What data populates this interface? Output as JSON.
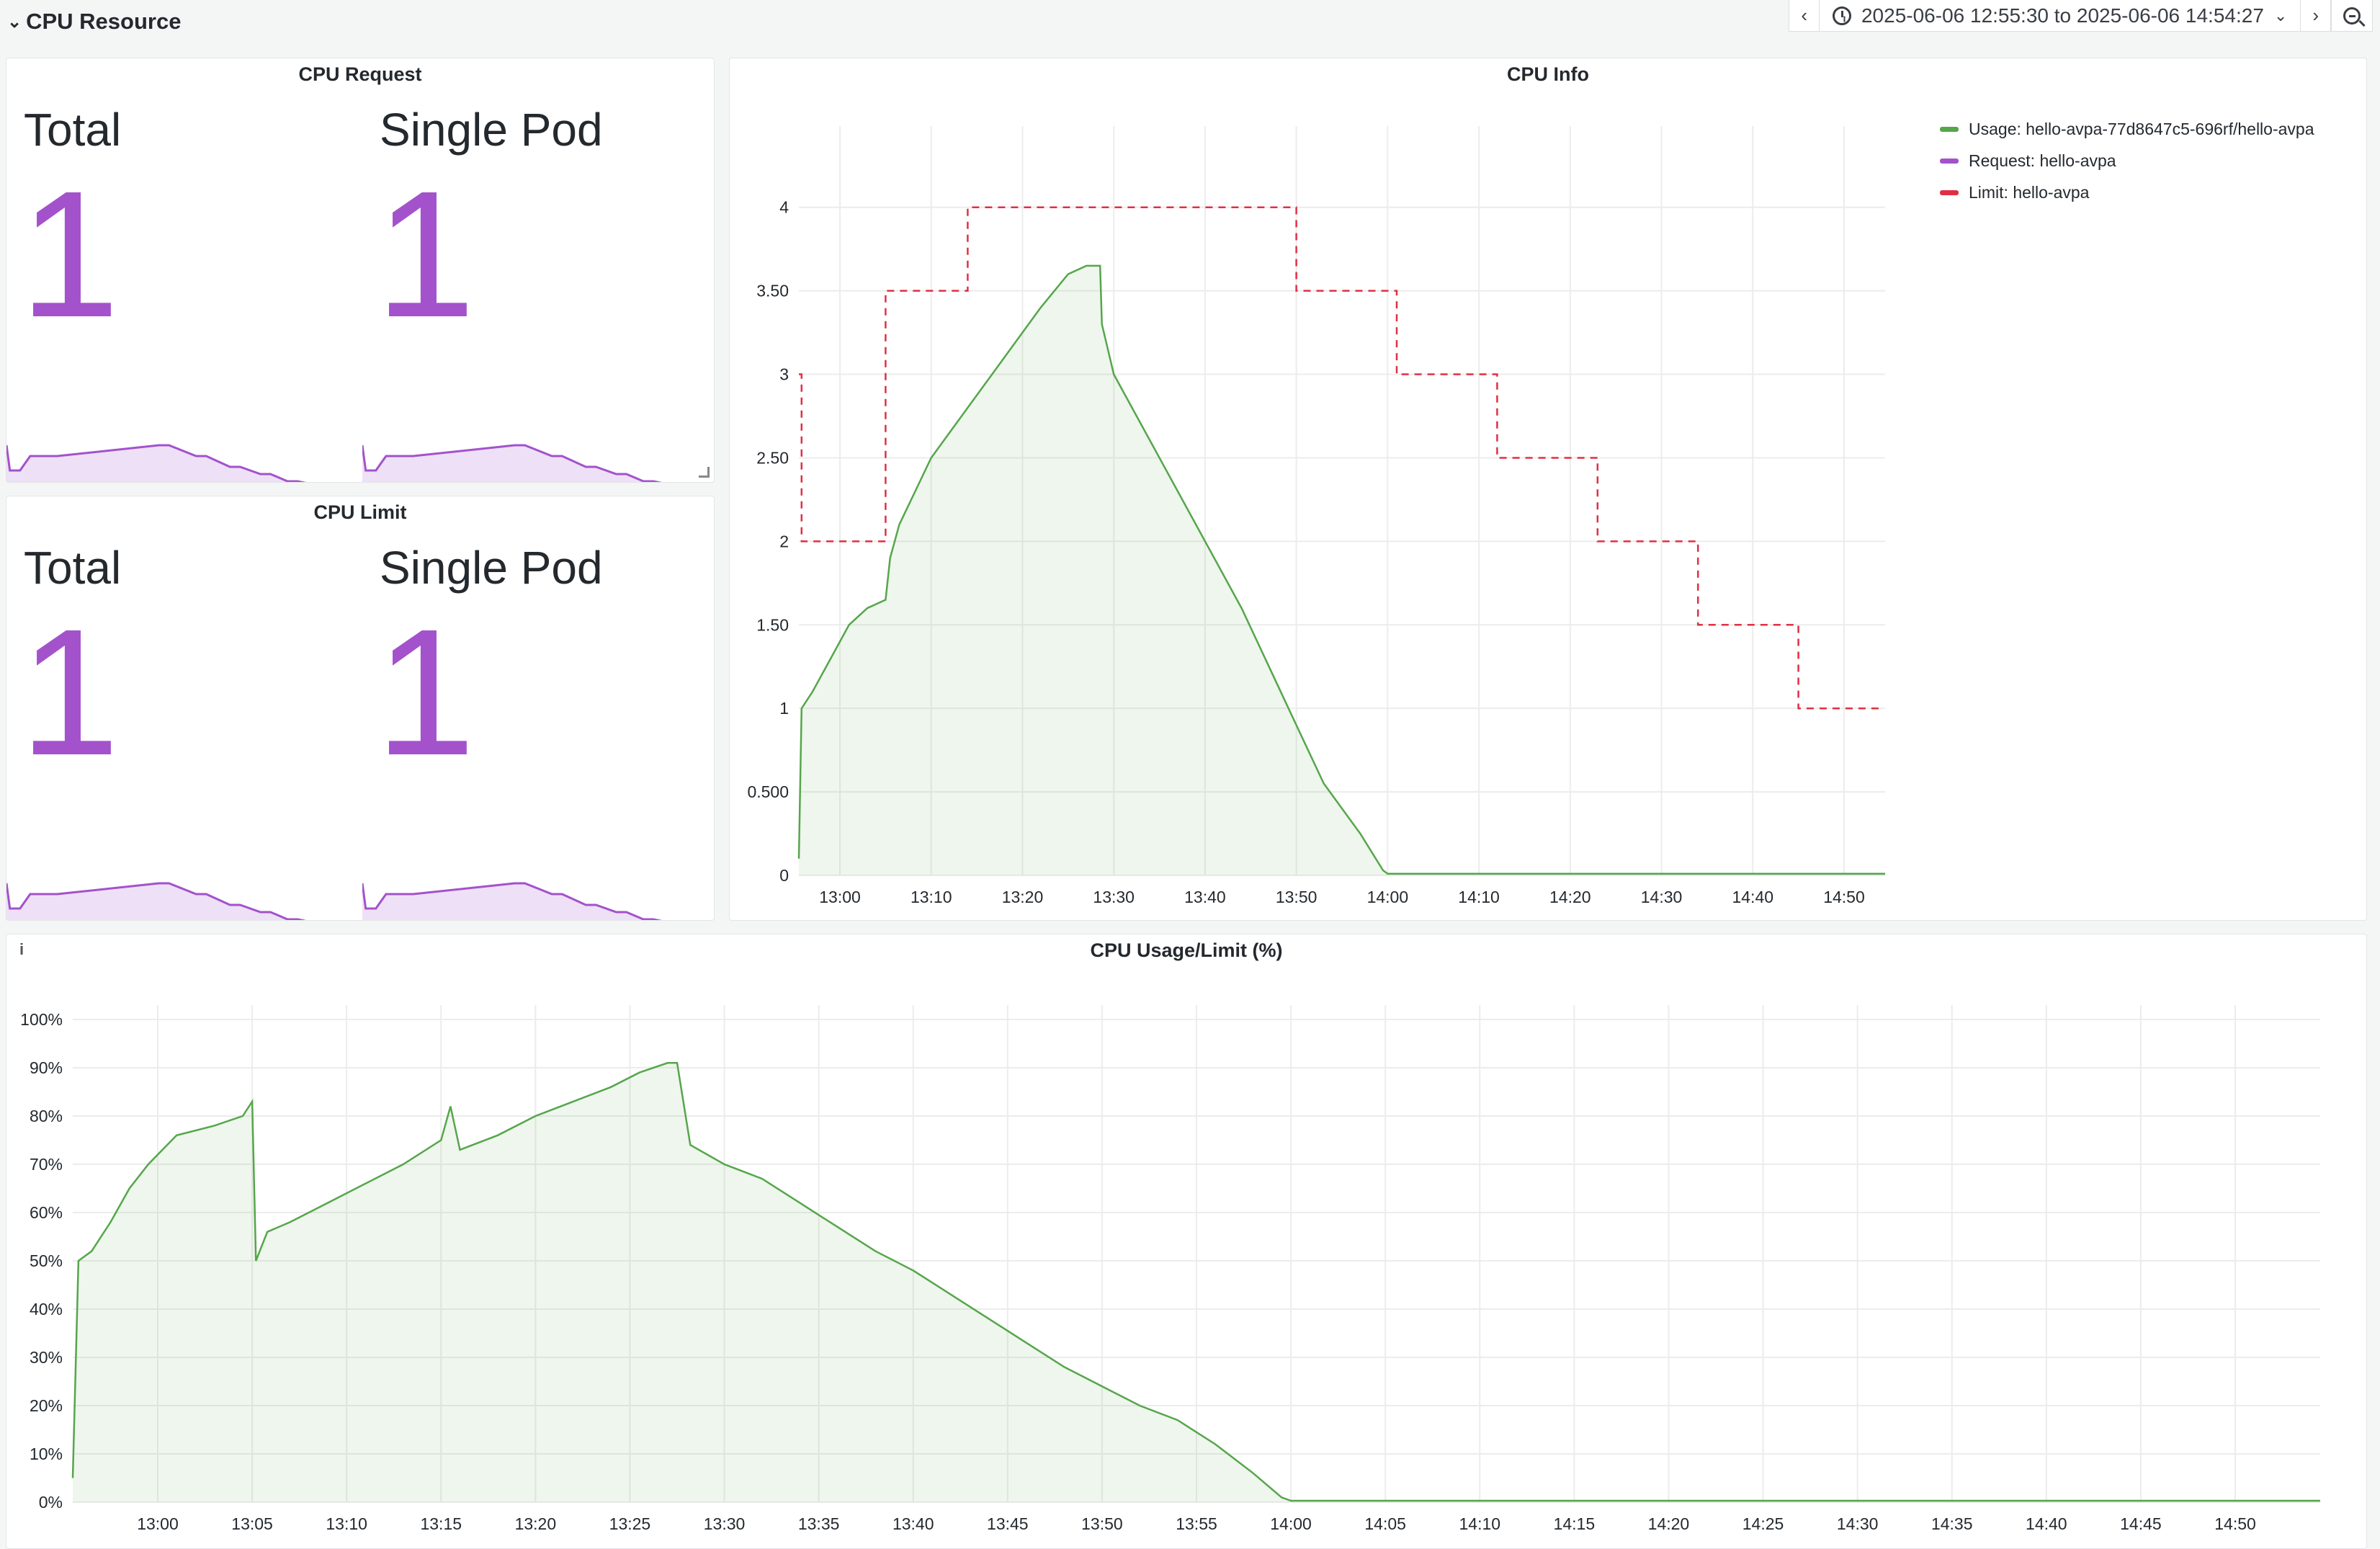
{
  "row": {
    "title": "CPU Resource"
  },
  "toolbar": {
    "time_range": "2025-06-06 12:55:30 to 2025-06-06 14:54:27"
  },
  "colors": {
    "purple": "#a352cc",
    "green": "#56a64b",
    "red": "#e02f44"
  },
  "cpu_request": {
    "title": "CPU Request",
    "total_label": "Total",
    "total_value": "1",
    "pod_label": "Single Pod",
    "pod_value": "1"
  },
  "cpu_limit": {
    "title": "CPU Limit",
    "total_label": "Total",
    "total_value": "1",
    "pod_label": "Single Pod",
    "pod_value": "1"
  },
  "cpu_info": {
    "title": "CPU Info",
    "legend": [
      {
        "label": "Usage: hello-avpa-77d8647c5-696rf/hello-avpa",
        "color": "#56a64b"
      },
      {
        "label": "Request: hello-avpa",
        "color": "#a352cc"
      },
      {
        "label": "Limit: hello-avpa",
        "color": "#e02f44"
      }
    ]
  },
  "usage_limit": {
    "title": "CPU Usage/Limit (%)"
  },
  "chart_data": [
    {
      "type": "line",
      "title": "CPU Info",
      "x_unit": "minutes past 12:00",
      "xlim": [
        55.5,
        174.5
      ],
      "ylim": [
        0,
        4.4
      ],
      "yticks": [
        0,
        0.5,
        1,
        1.5,
        2,
        2.5,
        3,
        3.5,
        4
      ],
      "ytick_labels": [
        "0",
        "0.500",
        "1",
        "1.50",
        "2",
        "2.50",
        "3",
        "3.50",
        "4"
      ],
      "xticks": [
        60,
        70,
        80,
        90,
        100,
        110,
        120,
        130,
        140,
        150,
        160,
        170
      ],
      "xtick_labels": [
        "13:00",
        "13:10",
        "13:20",
        "13:30",
        "13:40",
        "13:50",
        "14:00",
        "14:10",
        "14:20",
        "14:30",
        "14:40",
        "14:50"
      ],
      "grid": true,
      "series": [
        {
          "name": "Usage: hello-avpa-77d8647c5-696rf/hello-avpa",
          "style": "area",
          "x": [
            55.5,
            55.8,
            57,
            59,
            61,
            63,
            65,
            65.5,
            66.5,
            70,
            74,
            78,
            82,
            85,
            87,
            88.5,
            88.7,
            90,
            92,
            95,
            98,
            101,
            104,
            107,
            110,
            113,
            117,
            119.5,
            120,
            174.5
          ],
          "y": [
            0.1,
            1.0,
            1.1,
            1.3,
            1.5,
            1.6,
            1.65,
            1.9,
            2.1,
            2.5,
            2.8,
            3.1,
            3.4,
            3.6,
            3.65,
            3.65,
            3.3,
            3.0,
            2.8,
            2.5,
            2.2,
            1.9,
            1.6,
            1.25,
            0.9,
            0.55,
            0.25,
            0.03,
            0.01,
            0.01
          ]
        },
        {
          "name": "Limit: hello-avpa",
          "style": "step-dashed",
          "x": [
            55.5,
            55.8,
            65,
            74,
            110,
            121,
            132,
            143,
            154,
            165,
            174
          ],
          "y": [
            3,
            2,
            3.5,
            4,
            3.5,
            3,
            2.5,
            2,
            1.5,
            1,
            1
          ]
        }
      ]
    },
    {
      "type": "area",
      "title": "CPU Usage/Limit (%)",
      "x_unit": "minutes past 12:00",
      "xlim": [
        55.5,
        174.5
      ],
      "ylim": [
        0,
        100
      ],
      "yticks": [
        0,
        10,
        20,
        30,
        40,
        50,
        60,
        70,
        80,
        90,
        100
      ],
      "ytick_labels": [
        "0%",
        "10%",
        "20%",
        "30%",
        "40%",
        "50%",
        "60%",
        "70%",
        "80%",
        "90%",
        "100%"
      ],
      "xticks": [
        60,
        65,
        70,
        75,
        80,
        85,
        90,
        95,
        100,
        105,
        110,
        115,
        120,
        125,
        130,
        135,
        140,
        145,
        150,
        155,
        160,
        165,
        170
      ],
      "xtick_labels": [
        "13:00",
        "13:05",
        "13:10",
        "13:15",
        "13:20",
        "13:25",
        "13:30",
        "13:35",
        "13:40",
        "13:45",
        "13:50",
        "13:55",
        "14:00",
        "14:05",
        "14:10",
        "14:15",
        "14:20",
        "14:25",
        "14:30",
        "14:35",
        "14:40",
        "14:45",
        "14:50"
      ],
      "grid": true,
      "series": [
        {
          "name": "",
          "style": "area",
          "x": [
            55.5,
            55.8,
            56.5,
            57.5,
            58.5,
            59.5,
            61,
            63,
            64.5,
            65,
            65.2,
            65.8,
            67,
            69,
            71,
            73,
            75,
            75.5,
            76,
            78,
            80,
            82,
            84,
            85.5,
            87,
            87.5,
            88.2,
            90,
            92,
            94,
            96,
            98,
            100,
            102,
            104,
            106,
            108,
            110,
            112,
            114,
            116,
            118,
            119.5,
            120,
            174.5
          ],
          "y": [
            5,
            50,
            52,
            58,
            65,
            70,
            76,
            78,
            80,
            83,
            50,
            56,
            58,
            62,
            66,
            70,
            75,
            82,
            73,
            76,
            80,
            83,
            86,
            89,
            91,
            91,
            74,
            70,
            67,
            62,
            57,
            52,
            48,
            43,
            38,
            33,
            28,
            24,
            20,
            17,
            12,
            6,
            1,
            0.3,
            0.3
          ]
        }
      ]
    }
  ]
}
